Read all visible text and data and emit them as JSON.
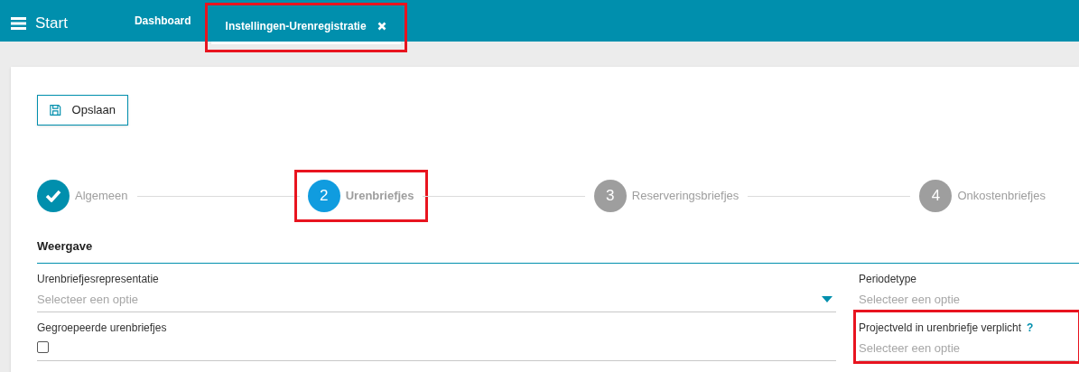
{
  "header": {
    "menu_label": "Start",
    "tabs": [
      {
        "label": "Dashboard",
        "selected": false,
        "closable": false,
        "highlighted": false
      },
      {
        "label": "Instellingen-Urenregistratie",
        "selected": true,
        "closable": true,
        "highlighted": true
      }
    ]
  },
  "toolbar": {
    "save_button": "Opslaan"
  },
  "stepper": [
    {
      "label": "Algemeen",
      "completed": true,
      "selected": false,
      "highlighted": false
    },
    {
      "number": "2",
      "label": "Urenbriefjes",
      "completed": false,
      "selected": true,
      "highlighted": true
    },
    {
      "number": "3",
      "label": "Reserveringsbriefjes",
      "completed": false,
      "selected": false,
      "highlighted": false
    },
    {
      "number": "4",
      "label": "Onkostenbriefjes",
      "completed": false,
      "selected": false,
      "highlighted": false
    }
  ],
  "section": {
    "title": "Weergave"
  },
  "fields": [
    {
      "kind": "select",
      "label": "Urenbriefjesrepresentatie",
      "placeholder": "Selecteer een optie",
      "dropdown_arrow": true,
      "highlighted": false
    },
    {
      "kind": "select",
      "label": "Periodetype",
      "placeholder": "Selecteer een optie",
      "dropdown_arrow": false,
      "highlighted": false
    },
    {
      "kind": "checkbox",
      "label": "Gegroepeerde urenbriefjes",
      "checked": false,
      "highlighted": false
    },
    {
      "kind": "select",
      "label": "Projectveld in urenbriefje verplicht",
      "help": "?",
      "placeholder": "Selecteer een optie",
      "dropdown_arrow": false,
      "highlighted": true
    }
  ]
}
